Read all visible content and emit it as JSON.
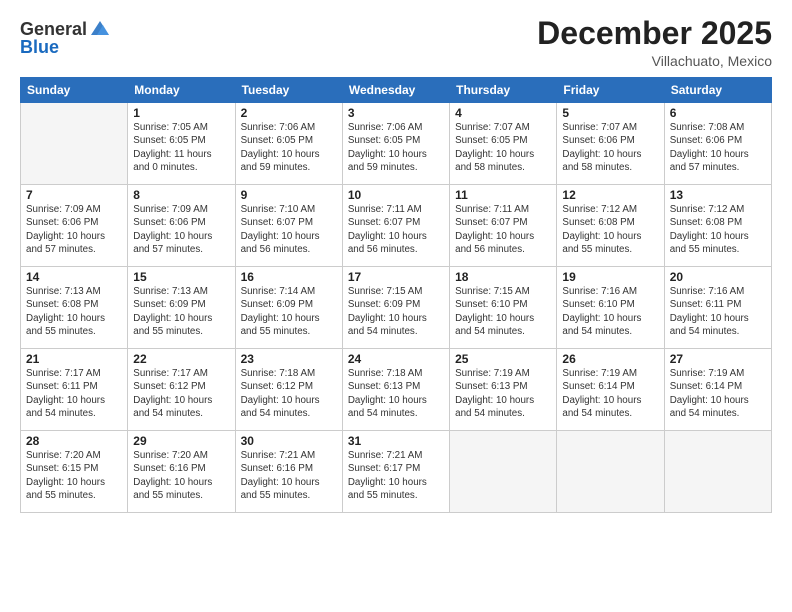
{
  "header": {
    "logo_general": "General",
    "logo_blue": "Blue",
    "month": "December 2025",
    "location": "Villachuato, Mexico"
  },
  "days_of_week": [
    "Sunday",
    "Monday",
    "Tuesday",
    "Wednesday",
    "Thursday",
    "Friday",
    "Saturday"
  ],
  "weeks": [
    [
      {
        "day": "",
        "info": ""
      },
      {
        "day": "1",
        "info": "Sunrise: 7:05 AM\nSunset: 6:05 PM\nDaylight: 11 hours\nand 0 minutes."
      },
      {
        "day": "2",
        "info": "Sunrise: 7:06 AM\nSunset: 6:05 PM\nDaylight: 10 hours\nand 59 minutes."
      },
      {
        "day": "3",
        "info": "Sunrise: 7:06 AM\nSunset: 6:05 PM\nDaylight: 10 hours\nand 59 minutes."
      },
      {
        "day": "4",
        "info": "Sunrise: 7:07 AM\nSunset: 6:05 PM\nDaylight: 10 hours\nand 58 minutes."
      },
      {
        "day": "5",
        "info": "Sunrise: 7:07 AM\nSunset: 6:06 PM\nDaylight: 10 hours\nand 58 minutes."
      },
      {
        "day": "6",
        "info": "Sunrise: 7:08 AM\nSunset: 6:06 PM\nDaylight: 10 hours\nand 57 minutes."
      }
    ],
    [
      {
        "day": "7",
        "info": "Sunrise: 7:09 AM\nSunset: 6:06 PM\nDaylight: 10 hours\nand 57 minutes."
      },
      {
        "day": "8",
        "info": "Sunrise: 7:09 AM\nSunset: 6:06 PM\nDaylight: 10 hours\nand 57 minutes."
      },
      {
        "day": "9",
        "info": "Sunrise: 7:10 AM\nSunset: 6:07 PM\nDaylight: 10 hours\nand 56 minutes."
      },
      {
        "day": "10",
        "info": "Sunrise: 7:11 AM\nSunset: 6:07 PM\nDaylight: 10 hours\nand 56 minutes."
      },
      {
        "day": "11",
        "info": "Sunrise: 7:11 AM\nSunset: 6:07 PM\nDaylight: 10 hours\nand 56 minutes."
      },
      {
        "day": "12",
        "info": "Sunrise: 7:12 AM\nSunset: 6:08 PM\nDaylight: 10 hours\nand 55 minutes."
      },
      {
        "day": "13",
        "info": "Sunrise: 7:12 AM\nSunset: 6:08 PM\nDaylight: 10 hours\nand 55 minutes."
      }
    ],
    [
      {
        "day": "14",
        "info": "Sunrise: 7:13 AM\nSunset: 6:08 PM\nDaylight: 10 hours\nand 55 minutes."
      },
      {
        "day": "15",
        "info": "Sunrise: 7:13 AM\nSunset: 6:09 PM\nDaylight: 10 hours\nand 55 minutes."
      },
      {
        "day": "16",
        "info": "Sunrise: 7:14 AM\nSunset: 6:09 PM\nDaylight: 10 hours\nand 55 minutes."
      },
      {
        "day": "17",
        "info": "Sunrise: 7:15 AM\nSunset: 6:09 PM\nDaylight: 10 hours\nand 54 minutes."
      },
      {
        "day": "18",
        "info": "Sunrise: 7:15 AM\nSunset: 6:10 PM\nDaylight: 10 hours\nand 54 minutes."
      },
      {
        "day": "19",
        "info": "Sunrise: 7:16 AM\nSunset: 6:10 PM\nDaylight: 10 hours\nand 54 minutes."
      },
      {
        "day": "20",
        "info": "Sunrise: 7:16 AM\nSunset: 6:11 PM\nDaylight: 10 hours\nand 54 minutes."
      }
    ],
    [
      {
        "day": "21",
        "info": "Sunrise: 7:17 AM\nSunset: 6:11 PM\nDaylight: 10 hours\nand 54 minutes."
      },
      {
        "day": "22",
        "info": "Sunrise: 7:17 AM\nSunset: 6:12 PM\nDaylight: 10 hours\nand 54 minutes."
      },
      {
        "day": "23",
        "info": "Sunrise: 7:18 AM\nSunset: 6:12 PM\nDaylight: 10 hours\nand 54 minutes."
      },
      {
        "day": "24",
        "info": "Sunrise: 7:18 AM\nSunset: 6:13 PM\nDaylight: 10 hours\nand 54 minutes."
      },
      {
        "day": "25",
        "info": "Sunrise: 7:19 AM\nSunset: 6:13 PM\nDaylight: 10 hours\nand 54 minutes."
      },
      {
        "day": "26",
        "info": "Sunrise: 7:19 AM\nSunset: 6:14 PM\nDaylight: 10 hours\nand 54 minutes."
      },
      {
        "day": "27",
        "info": "Sunrise: 7:19 AM\nSunset: 6:14 PM\nDaylight: 10 hours\nand 54 minutes."
      }
    ],
    [
      {
        "day": "28",
        "info": "Sunrise: 7:20 AM\nSunset: 6:15 PM\nDaylight: 10 hours\nand 55 minutes."
      },
      {
        "day": "29",
        "info": "Sunrise: 7:20 AM\nSunset: 6:16 PM\nDaylight: 10 hours\nand 55 minutes."
      },
      {
        "day": "30",
        "info": "Sunrise: 7:21 AM\nSunset: 6:16 PM\nDaylight: 10 hours\nand 55 minutes."
      },
      {
        "day": "31",
        "info": "Sunrise: 7:21 AM\nSunset: 6:17 PM\nDaylight: 10 hours\nand 55 minutes."
      },
      {
        "day": "",
        "info": ""
      },
      {
        "day": "",
        "info": ""
      },
      {
        "day": "",
        "info": ""
      }
    ]
  ]
}
